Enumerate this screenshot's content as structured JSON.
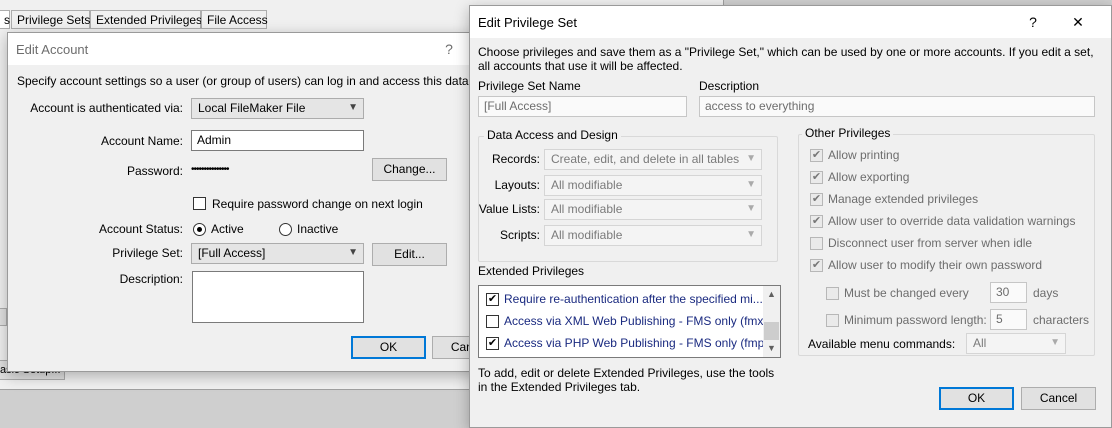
{
  "background": {
    "tabs": [
      "s",
      "Privilege Sets",
      "Extended Privileges",
      "File Access"
    ],
    "edge_button": "asic Setup..."
  },
  "edit_account": {
    "title": "Edit Account",
    "help": "?",
    "intro": "Specify account settings so a user (or group of users) can log in and access this database",
    "auth_label": "Account is authenticated via:",
    "auth_value": "Local FileMaker File",
    "name_label": "Account Name:",
    "name_value": "Admin",
    "password_label": "Password:",
    "password_value": "•••••••••••••••",
    "change_button": "Change...",
    "require_change_label": "Require password change on next login",
    "require_change_checked": false,
    "status_label": "Account Status:",
    "status_active": "Active",
    "status_inactive": "Inactive",
    "status_selected": "Active",
    "privilege_label": "Privilege Set:",
    "privilege_value": "[Full Access]",
    "edit_button": "Edit...",
    "description_label": "Description:",
    "description_value": "",
    "ok_button": "OK",
    "cancel_button": "Cancel"
  },
  "edit_privilege_set": {
    "title": "Edit Privilege Set",
    "help": "?",
    "close": "✕",
    "intro": "Choose privileges and save them as a \"Privilege Set,\" which can be used by one or more accounts. If you edit a set, all accounts that use it will be affected.",
    "name_label": "Privilege Set Name",
    "name_value": "[Full Access]",
    "description_label": "Description",
    "description_value": "access to everything",
    "data_access": {
      "title": "Data Access and Design",
      "rows": [
        {
          "label": "Records:",
          "value": "Create, edit, and delete in all tables"
        },
        {
          "label": "Layouts:",
          "value": "All modifiable"
        },
        {
          "label": "Value Lists:",
          "value": "All modifiable"
        },
        {
          "label": "Scripts:",
          "value": "All modifiable"
        }
      ]
    },
    "extended": {
      "title": "Extended Privileges",
      "items": [
        {
          "label": "Require re-authentication after the specified mi...",
          "checked": true
        },
        {
          "label": "Access via XML Web Publishing - FMS only (fmxml)",
          "checked": false
        },
        {
          "label": "Access via PHP Web Publishing - FMS only (fmp...",
          "checked": true
        }
      ],
      "footnote": "To add, edit or delete Extended Privileges, use the tools in the Extended Privileges tab."
    },
    "other": {
      "title": "Other Privileges",
      "items": [
        {
          "label": "Allow printing",
          "checked": true
        },
        {
          "label": "Allow exporting",
          "checked": true
        },
        {
          "label": "Manage extended privileges",
          "checked": true
        },
        {
          "label": "Allow user to override data validation warnings",
          "checked": true
        },
        {
          "label": "Disconnect user from server when idle",
          "checked": false
        },
        {
          "label": "Allow user to modify their own password",
          "checked": true
        }
      ],
      "must_change_label": "Must be changed every",
      "must_change_value": "30",
      "must_change_unit": "days",
      "min_length_label": "Minimum password length:",
      "min_length_value": "5",
      "min_length_unit": "characters",
      "menu_label": "Available menu commands:",
      "menu_value": "All"
    },
    "ok_button": "OK",
    "cancel_button": "Cancel"
  }
}
